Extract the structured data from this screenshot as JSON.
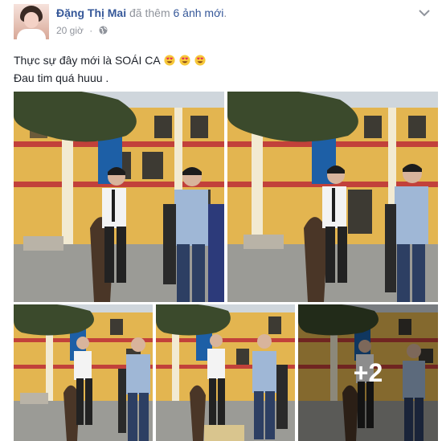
{
  "post": {
    "author": "Đặng Thị Mai",
    "action_prefix": "đã thêm",
    "action_count": "6 ảnh mới",
    "action_suffix": ".",
    "timestamp": "20 giờ",
    "separator": "·",
    "privacy_icon": "globe-icon",
    "options_icon": "chevron-down-icon",
    "text_line_1": "Thực sự đây mới là SOÁI CA",
    "text_line_1_emoji": "heart-eyes-emoji",
    "text_line_1_emoji_count": 3,
    "text_line_2": "Đau tim quá huuu .",
    "photos_shown": 5,
    "more_photos_label": "+2"
  },
  "colors": {
    "link_blue": "#365899",
    "meta_gray": "#90949c",
    "text_dark": "#1d2129",
    "building_yellow": "#e3b550",
    "building_trim": "#c2413a",
    "sign_blue": "#1d5fa6"
  }
}
